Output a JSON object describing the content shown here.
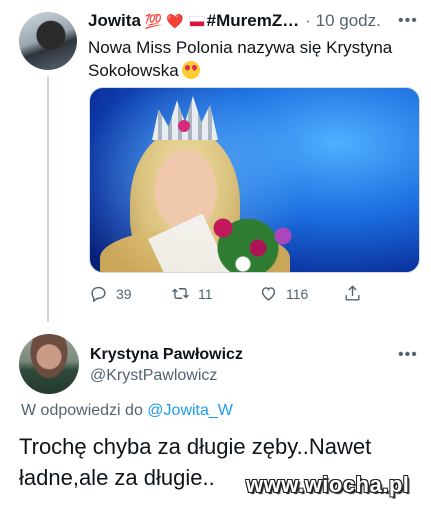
{
  "tweet1": {
    "author_name": "Jowita",
    "header_emojis": "💯 ❤️",
    "hashtag": "#MuremZ…",
    "time": "· 10 godz.",
    "text": "Nowa Miss Polonia nazywa się Krystyna Sokołowska",
    "replies": "39",
    "retweets": "11",
    "likes": "116"
  },
  "tweet2": {
    "author_name": "Krystyna Pawłowicz",
    "handle": "@KrystPawlowicz",
    "reply_prefix": "W odpowiedzi do",
    "reply_mention": "@Jowita_W",
    "text": "Trochę chyba za długie zęby..Nawet ładne,ale za długie.."
  },
  "watermark": "www.wiocha.pl",
  "colors": {
    "accent": "#1d9bf0",
    "secondary_text": "#536471",
    "primary_text": "#0f1419",
    "divider": "#cfd9de"
  },
  "icons": [
    "more-icon",
    "reply-icon",
    "retweet-icon",
    "like-icon",
    "share-icon",
    "flag-icon",
    "smiling-hearts-emoji-icon"
  ]
}
